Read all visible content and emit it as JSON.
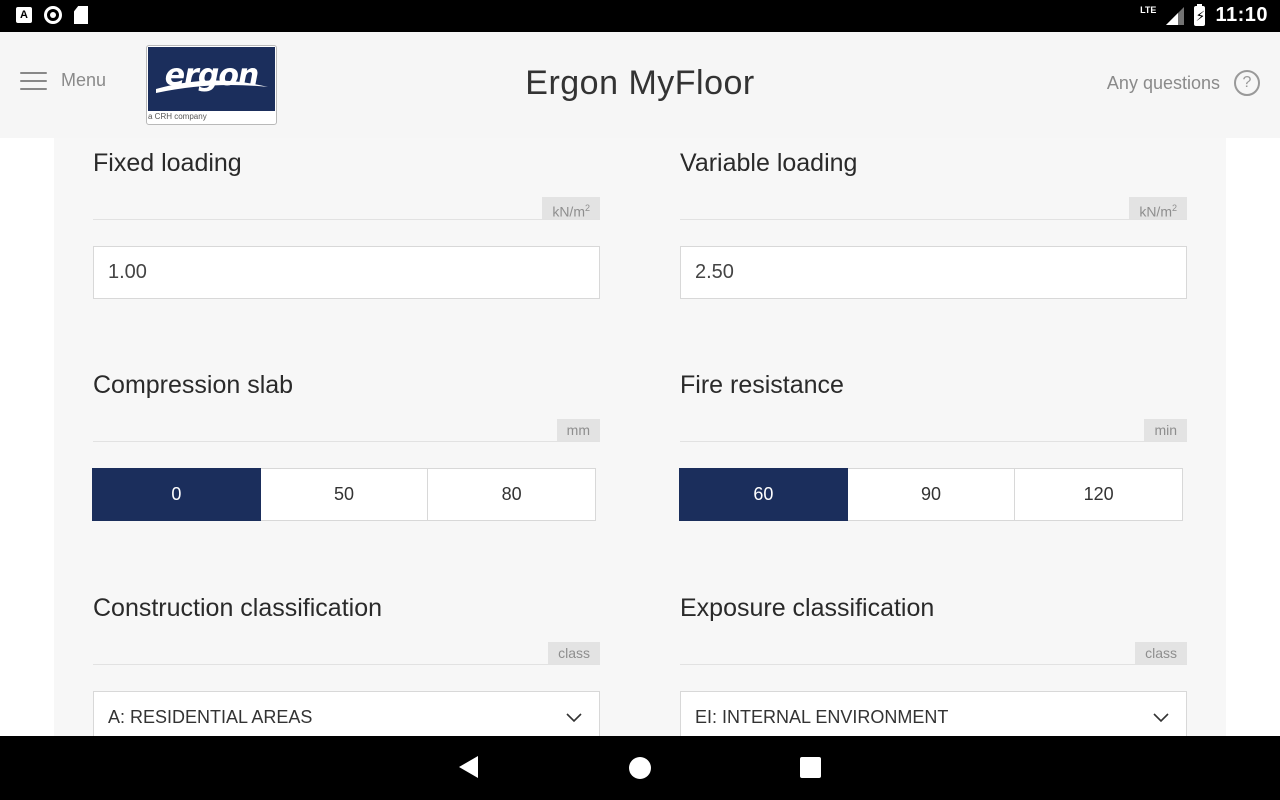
{
  "status_bar": {
    "notif_letter": "A",
    "network": "LTE",
    "time": "11:10"
  },
  "header": {
    "menu_label": "Menu",
    "logo_text": "ergon",
    "logo_subtext": "a CRH company",
    "title": "Ergon MyFloor",
    "help_label": "Any questions",
    "help_symbol": "?"
  },
  "colors": {
    "brand_navy": "#1b2e5c",
    "background": "#f7f7f7"
  },
  "fields": {
    "fixed_loading": {
      "title": "Fixed loading",
      "unit": "kN/m",
      "unit_sup": "2",
      "value": "1.00"
    },
    "variable_loading": {
      "title": "Variable loading",
      "unit": "kN/m",
      "unit_sup": "2",
      "value": "2.50"
    },
    "compression_slab": {
      "title": "Compression slab",
      "unit": "mm",
      "options": [
        "0",
        "50",
        "80"
      ],
      "selected": "0"
    },
    "fire_resistance": {
      "title": "Fire resistance",
      "unit": "min",
      "options": [
        "60",
        "90",
        "120"
      ],
      "selected": "60"
    },
    "construction_classification": {
      "title": "Construction classification",
      "unit": "class",
      "value": "A: RESIDENTIAL AREAS"
    },
    "exposure_classification": {
      "title": "Exposure classification",
      "unit": "class",
      "value": "EI: INTERNAL ENVIRONMENT"
    }
  }
}
